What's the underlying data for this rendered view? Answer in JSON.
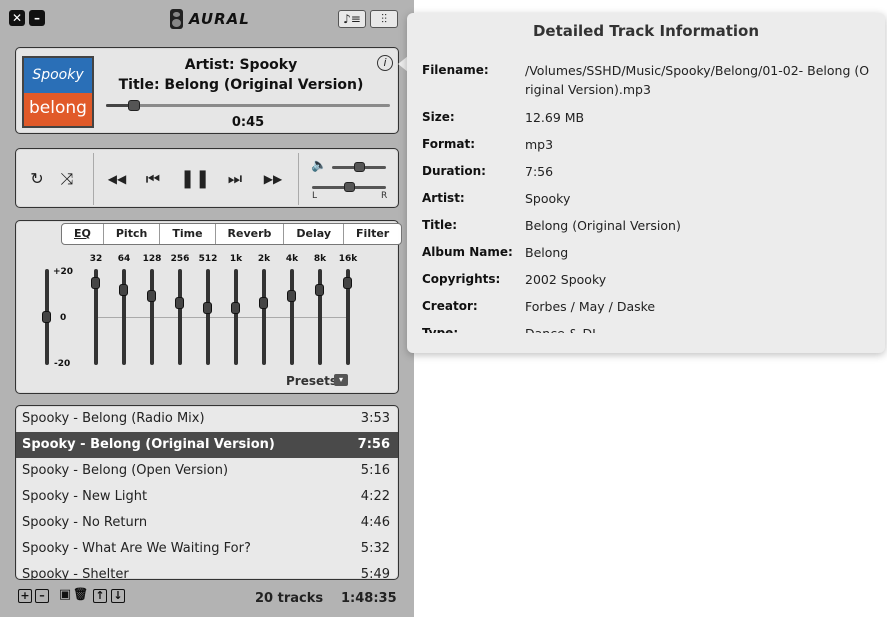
{
  "app": {
    "title": "AURAL"
  },
  "window": {
    "close": "✕",
    "minimize": "–"
  },
  "toolbar": {
    "playlist_toggle": "♪≡",
    "effects_toggle": "⫶⫶"
  },
  "now_playing": {
    "artist_line": "Artist: Spooky",
    "title_line": "Title: Belong (Original Version)",
    "position": "0:45",
    "progress_fraction": 0.1,
    "art_top": "Spooky",
    "art_bottom": "belong",
    "info_icon": "i"
  },
  "controls": {
    "repeat_icon": "↻",
    "shuffle_icon": "⤨",
    "rewind_icon": "◀◀",
    "previous_icon": "⏮",
    "pause_icon": "❚❚",
    "next_icon": "⏭",
    "forward_icon": "▶▶",
    "volume_icon": "🔈",
    "volume_fraction": 0.5,
    "balance_fraction": 0.5,
    "left_label": "L",
    "right_label": "R"
  },
  "effects": {
    "tabs": [
      "EQ",
      "Pitch",
      "Time",
      "Reverb",
      "Delay",
      "Filter"
    ],
    "active_tab": "EQ",
    "preamp_labels": {
      "top": "+20",
      "mid": "0",
      "bottom": "-20"
    },
    "preamp_fraction": 0.5,
    "bands": [
      {
        "label": "32",
        "fraction": 0.85
      },
      {
        "label": "64",
        "fraction": 0.78
      },
      {
        "label": "128",
        "fraction": 0.72
      },
      {
        "label": "256",
        "fraction": 0.65
      },
      {
        "label": "512",
        "fraction": 0.59
      },
      {
        "label": "1k",
        "fraction": 0.59
      },
      {
        "label": "2k",
        "fraction": 0.65
      },
      {
        "label": "4k",
        "fraction": 0.72
      },
      {
        "label": "8k",
        "fraction": 0.78
      },
      {
        "label": "16k",
        "fraction": 0.85
      }
    ],
    "presets_label": "Presets",
    "presets_arrow": "▾"
  },
  "playlist": {
    "tracks": [
      {
        "name": "Spooky - Belong (Radio Mix)",
        "duration": "3:53",
        "selected": false
      },
      {
        "name": "Spooky - Belong (Original Version)",
        "duration": "7:56",
        "selected": true
      },
      {
        "name": "Spooky - Belong (Open Version)",
        "duration": "5:16",
        "selected": false
      },
      {
        "name": "Spooky - New Light",
        "duration": "4:22",
        "selected": false
      },
      {
        "name": "Spooky - No Return",
        "duration": "4:46",
        "selected": false
      },
      {
        "name": "Spooky - What Are We Waiting For?",
        "duration": "5:32",
        "selected": false
      },
      {
        "name": "Spooky - Shelter",
        "duration": "5:49",
        "selected": false
      }
    ],
    "track_count": "20 tracks",
    "total_duration": "1:48:35",
    "add_icon": "+",
    "remove_icon": "–",
    "save_icon": "▣",
    "clear_icon": "🗑",
    "move_up_icon": "↑",
    "move_down_icon": "↓"
  },
  "track_info": {
    "title": "Detailed Track Information",
    "fields": [
      {
        "key": "Filename:",
        "value": "/Volumes/SSHD/Music/Spooky/Belong/01-02- Belong (Original Version).mp3"
      },
      {
        "key": "Size:",
        "value": "12.69 MB"
      },
      {
        "key": "Format:",
        "value": "mp3"
      },
      {
        "key": "Duration:",
        "value": "7:56"
      },
      {
        "key": "Artist:",
        "value": "Spooky"
      },
      {
        "key": "Title:",
        "value": "Belong (Original Version)"
      },
      {
        "key": "Album Name:",
        "value": "Belong"
      },
      {
        "key": "Copyrights:",
        "value": "2002 Spooky"
      },
      {
        "key": "Creator:",
        "value": "Forbes / May / Daske"
      },
      {
        "key": "Type:",
        "value": "Dance & DJ"
      }
    ]
  }
}
